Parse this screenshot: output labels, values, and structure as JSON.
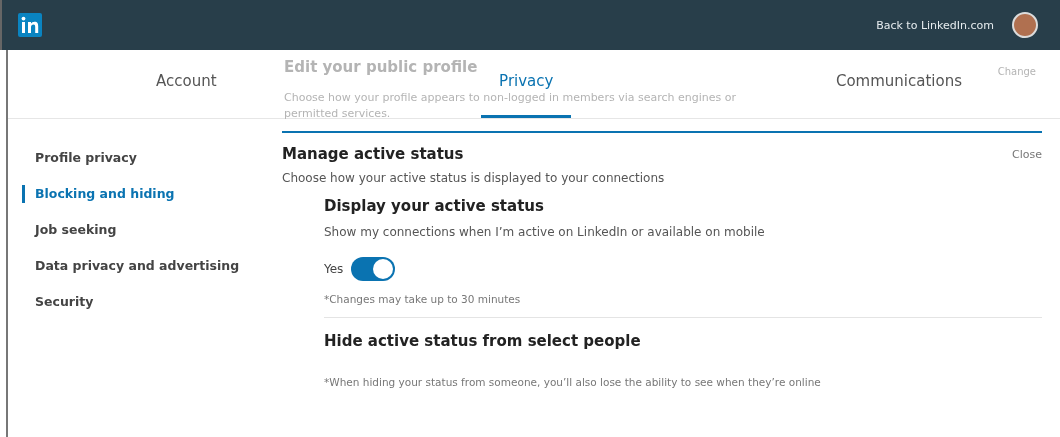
{
  "header": {
    "back_link": "Back to LinkedIn.com"
  },
  "background_section": {
    "title": "Edit your public profile",
    "description": "Choose how your profile appears to non-logged in members via search engines or permitted services.",
    "action": "Change"
  },
  "tabs": [
    {
      "label": "Account",
      "selected": false
    },
    {
      "label": "Privacy",
      "selected": true
    },
    {
      "label": "Communications",
      "selected": false
    }
  ],
  "sidebar": {
    "items": [
      {
        "label": "Profile privacy",
        "selected": false
      },
      {
        "label": "Blocking and hiding",
        "selected": true
      },
      {
        "label": "Job seeking",
        "selected": false
      },
      {
        "label": "Data privacy and advertising",
        "selected": false
      },
      {
        "label": "Security",
        "selected": false
      }
    ]
  },
  "panel": {
    "title": "Manage active status",
    "close": "Close",
    "description": "Choose how your active status is displayed to your connections",
    "display_status": {
      "title": "Display your active status",
      "description": "Show my connections when I’m active on LinkedIn or available on mobile",
      "toggle_label": "Yes",
      "on": true,
      "note": "*Changes may take up to 30 minutes"
    },
    "hide_status": {
      "title": "Hide active status from select people",
      "note": "*When hiding your status from someone, you’ll also lose the ability to see when they’re online"
    }
  }
}
